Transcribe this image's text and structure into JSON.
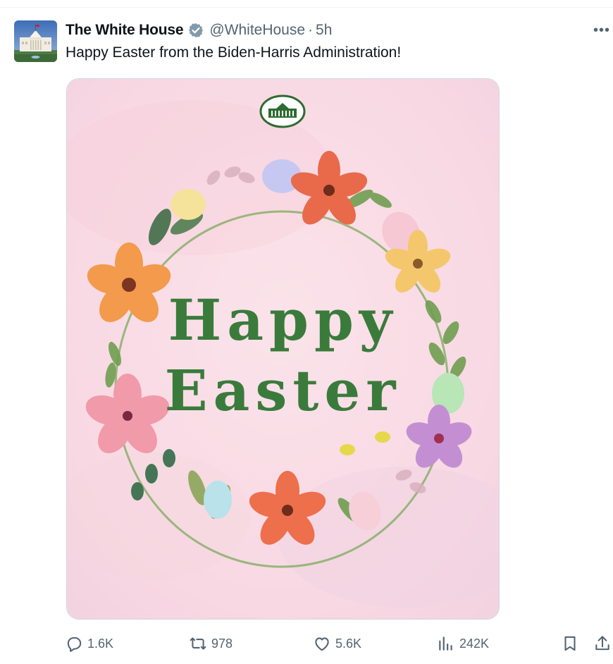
{
  "tweet": {
    "author_name": "The White House",
    "handle": "@WhiteHouse",
    "separator": "·",
    "time": "5h",
    "text": "Happy Easter from the Biden-Harris Administration!"
  },
  "card": {
    "line1": "Happy",
    "line2": "Easter"
  },
  "actions": {
    "replies": "1.6K",
    "reposts": "978",
    "likes": "5.6K",
    "views": "242K"
  },
  "icons": {
    "reply": "reply-icon",
    "repost": "repost-icon",
    "like": "heart-icon",
    "views": "views-icon",
    "bookmark": "bookmark-icon",
    "share": "share-icon",
    "verified": "verified-badge-icon",
    "more": "more-icon"
  },
  "colors": {
    "text_primary": "#0f1419",
    "text_secondary": "#536471",
    "verified_badge": "#829aab",
    "card_text_green": "#3a7b3c",
    "card_bg_pink": "#f9dfe8"
  }
}
